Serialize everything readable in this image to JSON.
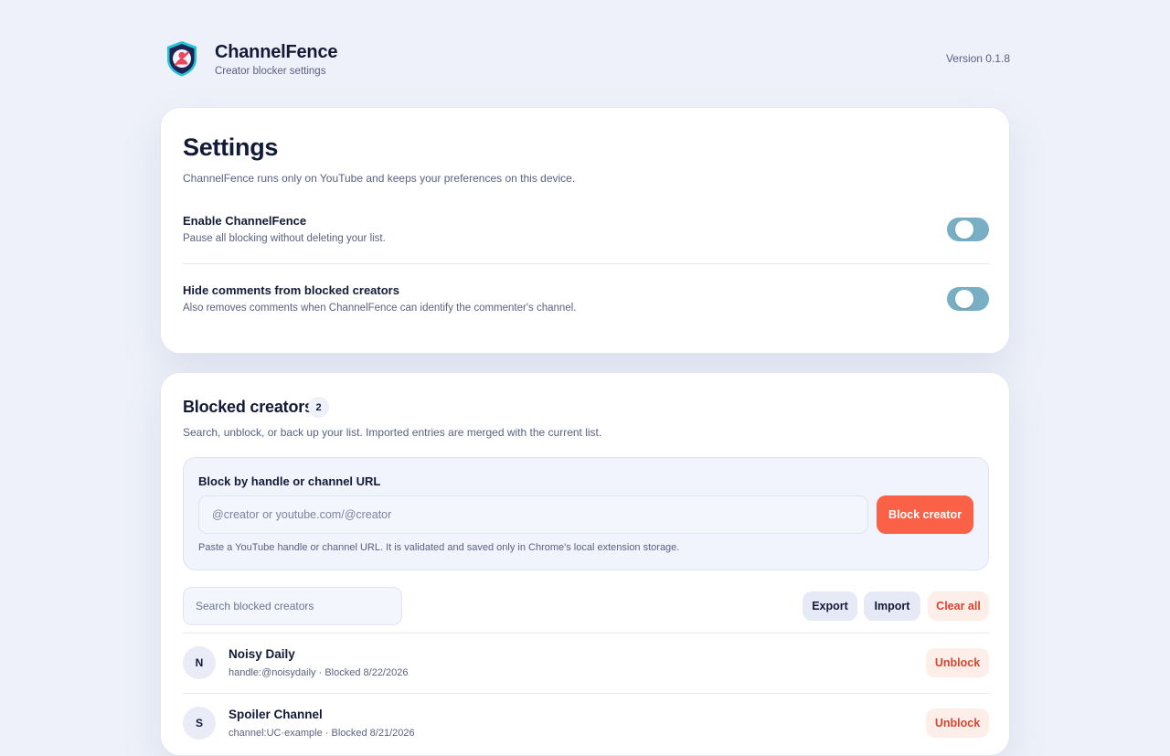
{
  "header": {
    "app_name": "ChannelFence",
    "subtitle": "Creator blocker settings",
    "version": "Version 0.1.8",
    "logo_icon": "shield-person-blocked-icon"
  },
  "settings": {
    "title": "Settings",
    "description": "ChannelFence runs only on YouTube and keeps your preferences on this device.",
    "options": [
      {
        "title": "Enable ChannelFence",
        "description": "Pause all blocking without deleting your list.",
        "enabled": true
      },
      {
        "title": "Hide comments from blocked creators",
        "description": "Also removes comments when ChannelFence can identify the commenter's channel.",
        "enabled": true
      }
    ]
  },
  "blocked": {
    "title": "Blocked creators",
    "count": "2",
    "description": "Search, unblock, or back up your list. Imported entries are merged with the current list.",
    "add_panel": {
      "title": "Block by handle or channel URL",
      "placeholder": "@creator or youtube.com/@creator",
      "value": "",
      "button_label": "Block creator",
      "note": "Paste a YouTube handle or channel URL. It is validated and saved only in Chrome's local extension storage."
    },
    "search": {
      "placeholder": "Search blocked creators",
      "value": ""
    },
    "actions": {
      "export_label": "Export",
      "import_label": "Import",
      "clear_label": "Clear all"
    },
    "creators": [
      {
        "initial": "N",
        "name": "Noisy Daily",
        "meta": "handle:@noisydaily · Blocked 8/22/2026",
        "unblock_label": "Unblock"
      },
      {
        "initial": "S",
        "name": "Spoiler Channel",
        "meta": "channel:UC·example · Blocked 8/21/2026",
        "unblock_label": "Unblock"
      }
    ]
  },
  "colors": {
    "background": "#eef1f9",
    "accent": "#fb6147",
    "toggle_on": "#78afc4",
    "danger_text": "#d8452f",
    "text_primary": "#131a38"
  }
}
